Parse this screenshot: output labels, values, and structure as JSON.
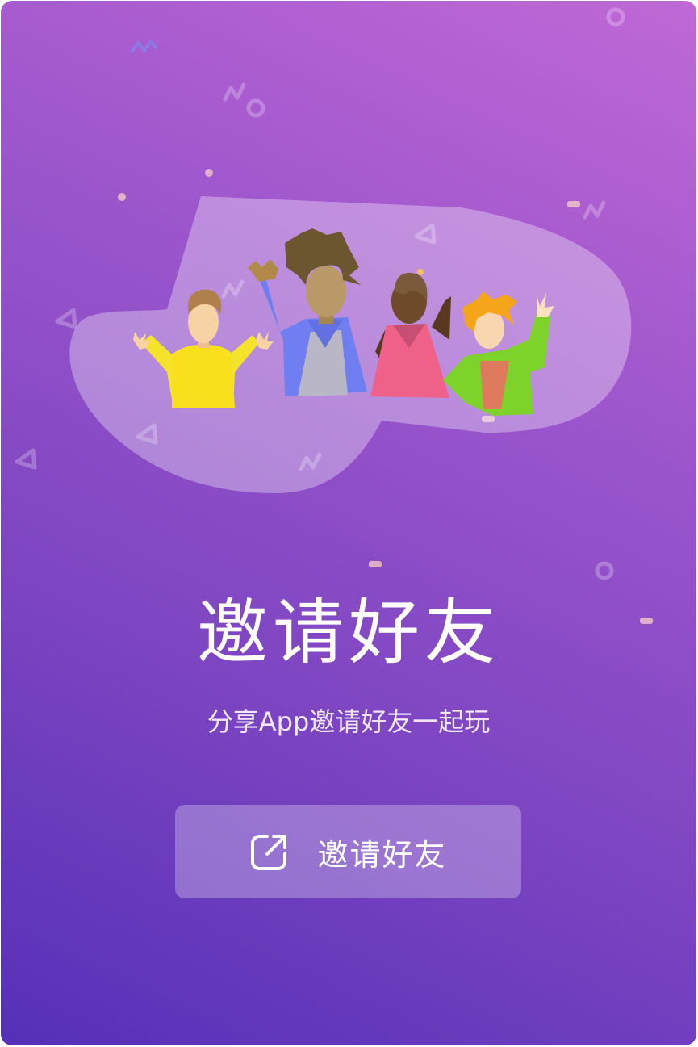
{
  "invite": {
    "title": "邀请好友",
    "subtitle": "分享App邀请好友一起玩",
    "button_label": "邀请好友",
    "button_icon": "share-icon"
  },
  "colors": {
    "gradient_top": "#c068d6",
    "gradient_bottom": "#5530b8",
    "button_background": "rgba(255,255,255,0.28)",
    "text": "#ffffff"
  }
}
